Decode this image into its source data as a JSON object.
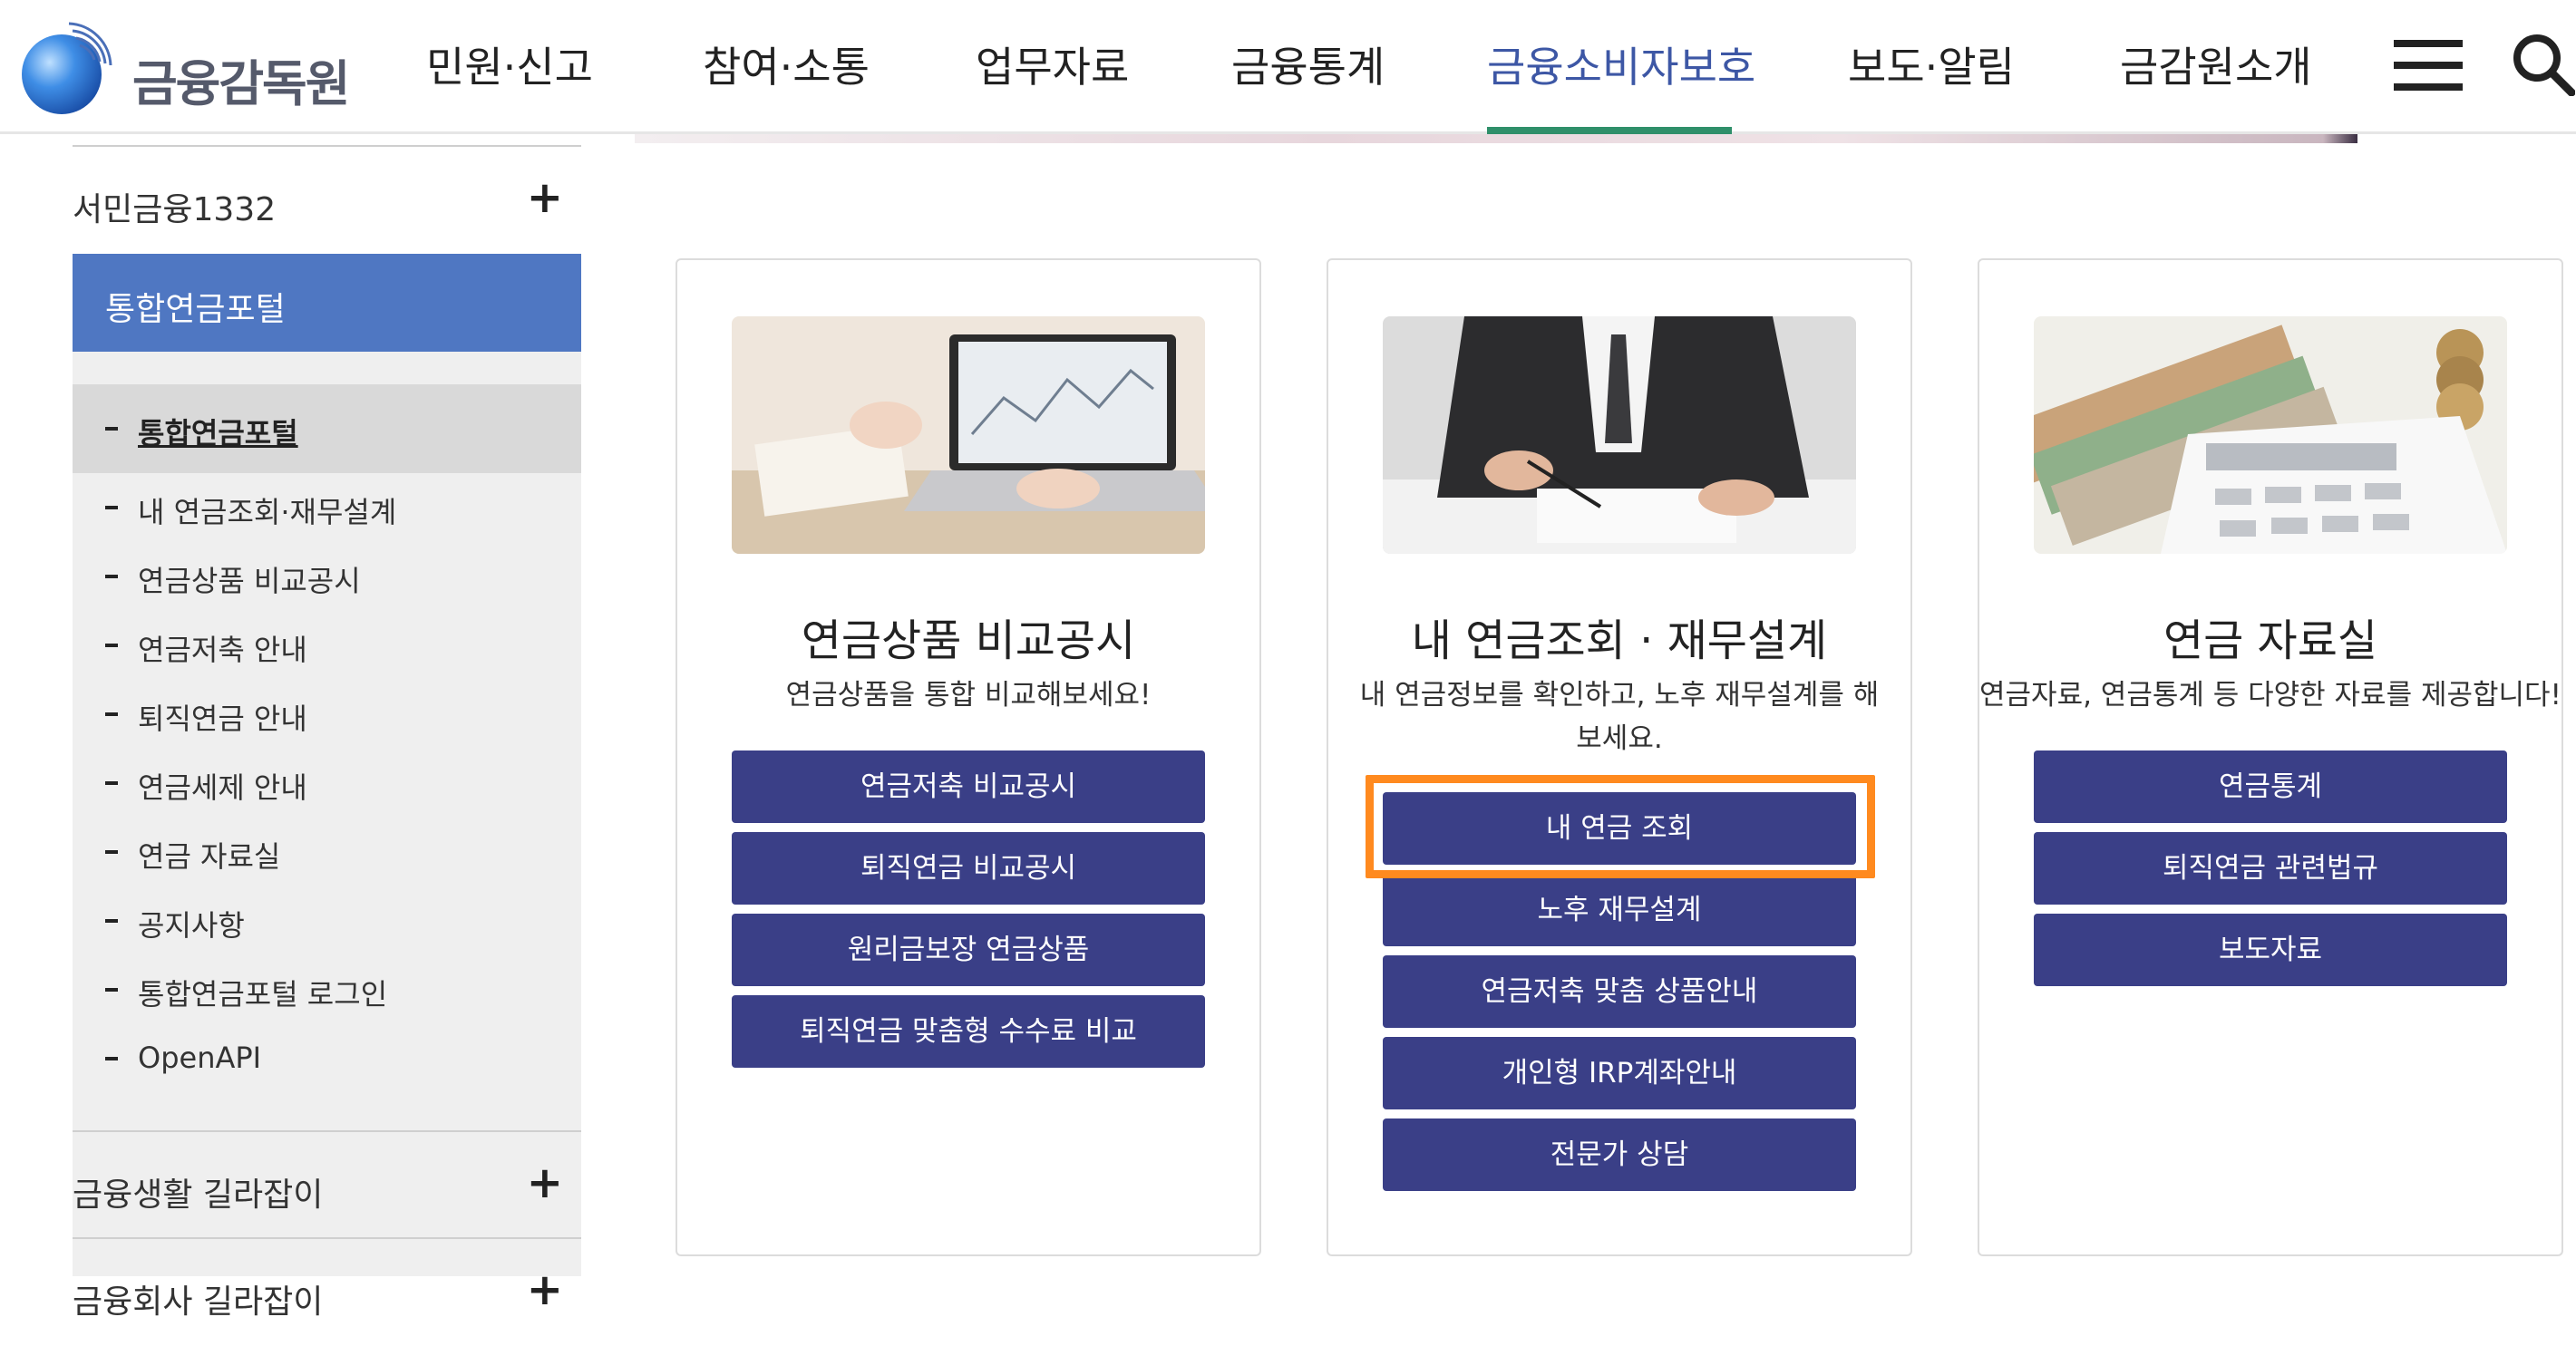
{
  "header": {
    "logo_text": "금융감독원",
    "nav": [
      {
        "label": "민원·신고"
      },
      {
        "label": "참여·소통"
      },
      {
        "label": "업무자료"
      },
      {
        "label": "금융통계"
      },
      {
        "label": "금융소비자보호"
      },
      {
        "label": "보도·알림"
      },
      {
        "label": "금감원소개"
      }
    ],
    "active_nav": "금융소비자보호",
    "colors": {
      "active": "#3d57a5",
      "underline": "#2f8f6a"
    }
  },
  "sidebar": {
    "top_item": {
      "label": "서민금융1332",
      "expand": "+"
    },
    "active_section": {
      "label": "통합연금포털"
    },
    "sub_items": [
      {
        "label": "통합연금포털",
        "current": true
      },
      {
        "label": "내 연금조회·재무설계"
      },
      {
        "label": "연금상품 비교공시"
      },
      {
        "label": "연금저축 안내"
      },
      {
        "label": "퇴직연금 안내"
      },
      {
        "label": "연금세제 안내"
      },
      {
        "label": "연금 자료실"
      },
      {
        "label": "공지사항"
      },
      {
        "label": "통합연금포털 로그인"
      },
      {
        "label": "OpenAPI"
      }
    ],
    "bottom_items": [
      {
        "label": "금융생활 길라잡이",
        "expand": "+"
      },
      {
        "label": "금융회사 길라잡이",
        "expand": "+"
      }
    ],
    "colors": {
      "active_bg": "#4f77c2",
      "sub_bg": "#efefef"
    }
  },
  "cards": [
    {
      "title": "연금상품 비교공시",
      "desc": "연금상품을 통합 비교해보세요!",
      "image_icon": "laptop-chart-photo",
      "buttons": [
        "연금저축 비교공시",
        "퇴직연금 비교공시",
        "원리금보장 연금상품",
        "퇴직연금 맞춤형 수수료 비교"
      ]
    },
    {
      "title": "내 연금조회 · 재무설계",
      "desc": "내 연금정보를 확인하고, 노후 재무설계를 해보세요.",
      "image_icon": "businessman-signing-photo",
      "buttons": [
        "내 연금 조회",
        "노후 재무설계",
        "연금저축 맞춤 상품안내",
        "개인형 IRP계좌안내",
        "전문가 상담"
      ],
      "highlighted_button": "내 연금 조회"
    },
    {
      "title": "연금 자료실",
      "desc": "연금자료, 연금통계 등 다양한 자료를 제공합니다!",
      "image_icon": "money-calculator-photo",
      "buttons": [
        "연금통계",
        "퇴직연금 관련법규",
        "보도자료"
      ]
    }
  ],
  "colors": {
    "button_bg": "#3a3f87",
    "highlight": "#ff8a1f"
  }
}
